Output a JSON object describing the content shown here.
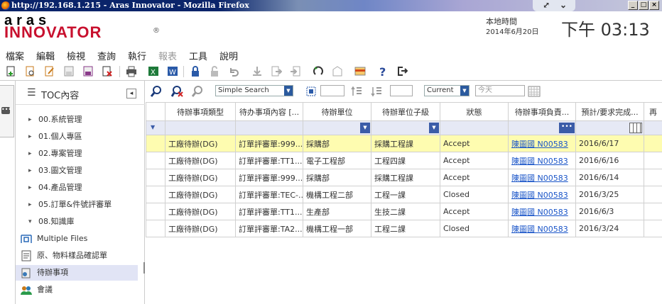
{
  "window": {
    "title": "http://192.168.1.215 - Aras Innovator - Mozilla Firefox"
  },
  "header": {
    "logo_top": "aras",
    "logo_main": "INNOVATOR",
    "logo_reg": "®",
    "time_label": "本地時間",
    "date": "2014年6月20日",
    "clock": "下午 03:13"
  },
  "menu": {
    "items": [
      "檔案",
      "編輯",
      "檢視",
      "查詢",
      "執行",
      "報表",
      "工具",
      "說明"
    ]
  },
  "toc": {
    "title": "TOC內容",
    "folders": [
      "00.系統管理",
      "01.個人專區",
      "02.專案管理",
      "03.圖文管理",
      "04.產品管理",
      "05.訂單&件號評審單",
      "08.知識庫"
    ],
    "items": [
      "Multiple Files",
      "原、物料樣品確認單",
      "待辦事項",
      "會議"
    ]
  },
  "grid_toolbar": {
    "search_mode": "Simple Search",
    "date_mode": "Current",
    "date_placeholder": "今天"
  },
  "grid": {
    "columns": [
      "待辦事項類型",
      "待办事項內容 [...",
      "待辦單位",
      "待辦單位子級",
      "狀態",
      "待辦事項負責...",
      "預計/要求完成...",
      "再"
    ],
    "rows": [
      [
        "工廠待辦(DG)",
        "訂單評審單:999...",
        "採購部",
        "採購工程課",
        "Accept",
        "陳圖國 N00583",
        "2016/6/17"
      ],
      [
        "工廠待辦(DG)",
        "訂單評審單:TT1...",
        "電子工程部",
        "工程四課",
        "Accept",
        "陳圖國 N00583",
        "2016/6/16"
      ],
      [
        "工廠待辦(DG)",
        "訂單評審單:999...",
        "採購部",
        "採購工程課",
        "Accept",
        "陳圖國 N00583",
        "2016/6/14"
      ],
      [
        "工廠待辦(DG)",
        "訂單評審單:TEC-...",
        "機構工程二部",
        "工程一課",
        "Closed",
        "陳圖國 N00583",
        "2016/3/25"
      ],
      [
        "工廠待辦(DG)",
        "訂單評審單:TT1...",
        "生產部",
        "生技二課",
        "Accept",
        "陳圖國 N00583",
        "2016/6/3"
      ],
      [
        "工廠待辦(DG)",
        "訂單評審單:TA2...",
        "機構工程一部",
        "工程二課",
        "Closed",
        "陳圖國 N00583",
        "2016/3/24"
      ]
    ],
    "selected_row": 0
  },
  "colors": {
    "brand_red": "#c8102e",
    "selected_row": "#fefcb0",
    "filter_row": "#e6e9f5",
    "link": "#1a55c8"
  }
}
